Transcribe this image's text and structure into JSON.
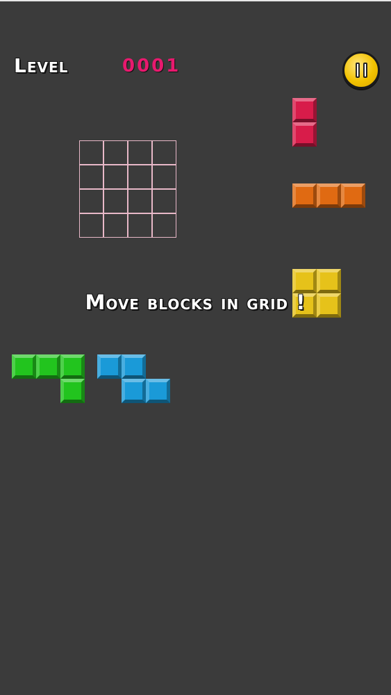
{
  "header": {
    "level_label": "Level",
    "level_number": "0001",
    "level_number_color": "#e8196e"
  },
  "pause_button": {
    "icon": "pause-icon",
    "color": "#f2c200"
  },
  "board": {
    "rows": 4,
    "cols": 4,
    "line_color": "#e8b8c8"
  },
  "instruction": "Move blocks in grid !",
  "pieces": [
    {
      "name": "red-vertical-domino-piece",
      "color": "red",
      "cells": [
        [
          0,
          0
        ],
        [
          1,
          0
        ]
      ]
    },
    {
      "name": "orange-horizontal-tromino-piece",
      "color": "orange",
      "cells": [
        [
          0,
          0
        ],
        [
          0,
          1
        ],
        [
          0,
          2
        ]
      ]
    },
    {
      "name": "yellow-square-piece",
      "color": "yellow",
      "cells": [
        [
          0,
          0
        ],
        [
          0,
          1
        ],
        [
          1,
          0
        ],
        [
          1,
          1
        ]
      ]
    },
    {
      "name": "green-j-piece",
      "color": "green",
      "cells": [
        [
          0,
          0
        ],
        [
          0,
          1
        ],
        [
          0,
          2
        ],
        [
          1,
          2
        ]
      ]
    },
    {
      "name": "blue-z-piece",
      "color": "blue",
      "cells": [
        [
          0,
          0
        ],
        [
          0,
          1
        ],
        [
          1,
          1
        ],
        [
          1,
          2
        ]
      ]
    }
  ],
  "colors": {
    "background": "#3b3b3b",
    "red": "#d81c4a",
    "orange": "#e06a12",
    "yellow": "#e6c21a",
    "green": "#22c41e",
    "blue": "#1a9ad8"
  }
}
